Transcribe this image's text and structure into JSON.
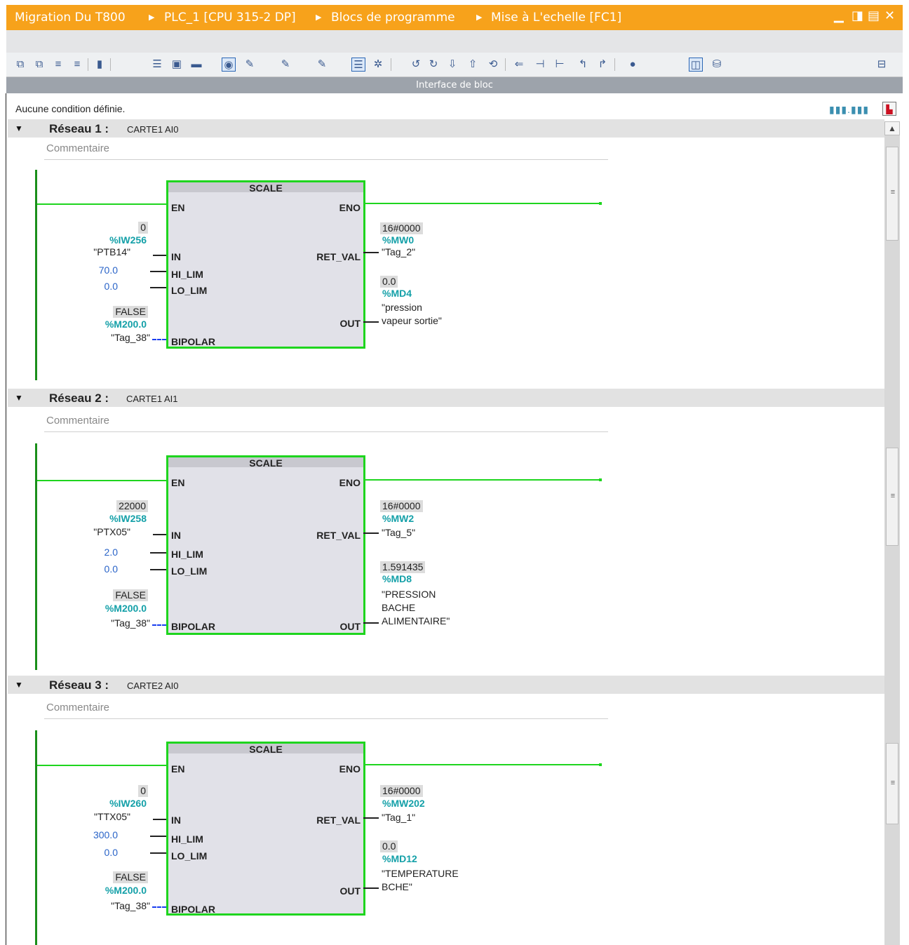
{
  "titlebar": {
    "project": "Migration Du T800",
    "device": "PLC_1 [CPU 315-2 DP]",
    "folder": "Blocs de programme",
    "block": "Mise à L'echelle [FC1]"
  },
  "interface_bar": {
    "label": "Interface de bloc"
  },
  "condition_text": "Aucune condition définie.",
  "colors": {
    "title_orange": "#f7a21b",
    "wire_green": "#1ed51e",
    "address_teal": "#14a0a8",
    "literal_blue": "#2a64c8",
    "bipolar_wire": "#1a3ef0"
  },
  "toolbar_icons": [
    "insert-network-icon",
    "delete-network-icon",
    "insert-row-icon",
    "add-row-icon",
    "open-branch-icon",
    "network-view-icon",
    "absolute-operands-icon",
    "favorites-icon",
    "comment-icon",
    "go-to-error-icon",
    "go-to-next-icon",
    "go-to-prev-icon",
    "list-view-icon",
    "call-structure-icon",
    "monitoring-icon",
    "compare-icon",
    "download-icon",
    "upload-icon",
    "reset-icon",
    "close-branch-icon",
    "set-icon",
    "reset-output-icon",
    "rising-edge-icon",
    "falling-edge-icon",
    "breakpoint-icon",
    "monitor-on-icon",
    "database-icon"
  ],
  "networks": [
    {
      "title": "Réseau 1 :",
      "subtitle": "CARTE1 AI0",
      "comment": "Commentaire",
      "block": {
        "name": "SCALE",
        "en": "EN",
        "eno": "ENO",
        "in": "IN",
        "hi_lim": "HI_LIM",
        "lo_lim": "LO_LIM",
        "bipolar": "BIPOLAR",
        "ret_val": "RET_VAL",
        "out": "OUT",
        "in_value": "0",
        "in_addr": "%IW256",
        "in_tag": "\"PTB14\"",
        "hi_lim_value": "70.0",
        "lo_lim_value": "0.0",
        "bipolar_value": "FALSE",
        "bipolar_addr": "%M200.0",
        "bipolar_tag": "\"Tag_38\"",
        "ret_value": "16#0000",
        "ret_addr": "%MW0",
        "ret_tag": "\"Tag_2\"",
        "out_value": "0.0",
        "out_addr": "%MD4",
        "out_tag_1": "\"pression",
        "out_tag_2": "vapeur sortie\"",
        "out_tag_3": ""
      }
    },
    {
      "title": "Réseau 2 :",
      "subtitle": "CARTE1 AI1",
      "comment": "Commentaire",
      "block": {
        "name": "SCALE",
        "en": "EN",
        "eno": "ENO",
        "in": "IN",
        "hi_lim": "HI_LIM",
        "lo_lim": "LO_LIM",
        "bipolar": "BIPOLAR",
        "ret_val": "RET_VAL",
        "out": "OUT",
        "in_value": "22000",
        "in_addr": "%IW258",
        "in_tag": "\"PTX05\"",
        "hi_lim_value": "2.0",
        "lo_lim_value": "0.0",
        "bipolar_value": "FALSE",
        "bipolar_addr": "%M200.0",
        "bipolar_tag": "\"Tag_38\"",
        "ret_value": "16#0000",
        "ret_addr": "%MW2",
        "ret_tag": "\"Tag_5\"",
        "out_value": "1.591435",
        "out_addr": "%MD8",
        "out_tag_1": "\"PRESSION",
        "out_tag_2": "BACHE",
        "out_tag_3": "ALIMENTAIRE\""
      }
    },
    {
      "title": "Réseau 3 :",
      "subtitle": "CARTE2 AI0",
      "comment": "Commentaire",
      "block": {
        "name": "SCALE",
        "en": "EN",
        "eno": "ENO",
        "in": "IN",
        "hi_lim": "HI_LIM",
        "lo_lim": "LO_LIM",
        "bipolar": "BIPOLAR",
        "ret_val": "RET_VAL",
        "out": "OUT",
        "in_value": "0",
        "in_addr": "%IW260",
        "in_tag": "\"TTX05\"",
        "hi_lim_value": "300.0",
        "lo_lim_value": "0.0",
        "bipolar_value": "FALSE",
        "bipolar_addr": "%M200.0",
        "bipolar_tag": "\"Tag_38\"",
        "ret_value": "16#0000",
        "ret_addr": "%MW202",
        "ret_tag": "\"Tag_1\"",
        "out_value": "0.0",
        "out_addr": "%MD12",
        "out_tag_1": "\"TEMPERATURE",
        "out_tag_2": "BCHE\"",
        "out_tag_3": ""
      }
    }
  ]
}
